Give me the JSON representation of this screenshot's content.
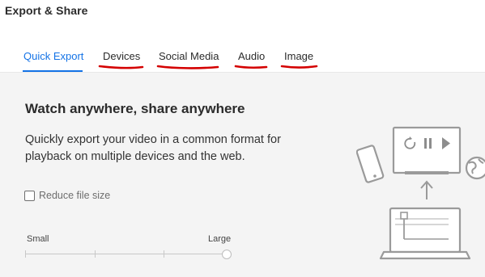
{
  "window": {
    "title": "Export & Share"
  },
  "tabs": [
    {
      "label": "Quick Export",
      "active": true
    },
    {
      "label": "Devices",
      "active": false
    },
    {
      "label": "Social Media",
      "active": false
    },
    {
      "label": "Audio",
      "active": false
    },
    {
      "label": "Image",
      "active": false
    }
  ],
  "main": {
    "heading": "Watch anywhere, share anywhere",
    "description": "Quickly export your video in a common format for playback on multiple devices and the web.",
    "reduce_checkbox": {
      "label": "Reduce file size",
      "checked": false
    },
    "size_slider": {
      "min_label": "Small",
      "max_label": "Large",
      "value_fraction": 1.0
    }
  },
  "illustration": {
    "icons": [
      "phone-icon",
      "monitor-icon",
      "play-icon",
      "pause-icon",
      "replay-icon",
      "arrow-up-icon",
      "laptop-icon",
      "globe-icon"
    ]
  },
  "colors": {
    "accent": "#1473e6",
    "annotation": "#d40000",
    "icon_gray": "#9a9a9a"
  }
}
